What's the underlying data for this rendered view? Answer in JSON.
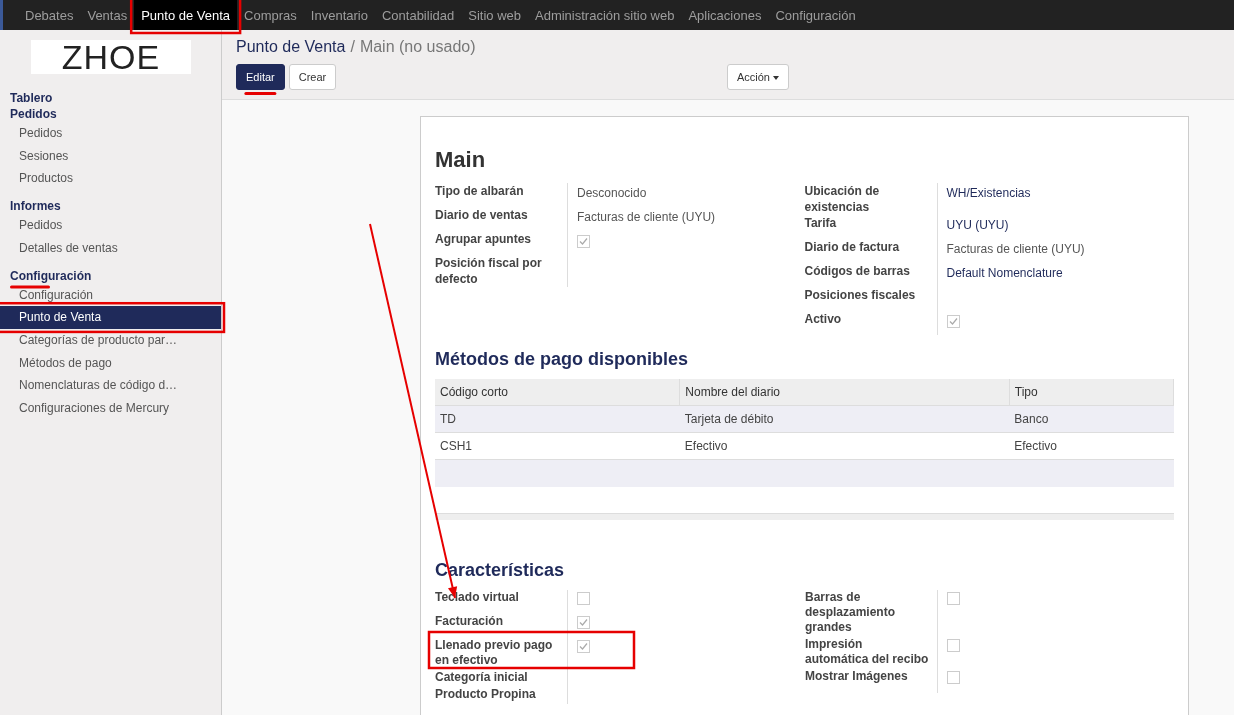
{
  "top_menu": [
    {
      "label": "Debates",
      "selected": false,
      "boxed": false
    },
    {
      "label": "Ventas",
      "selected": false,
      "boxed": false
    },
    {
      "label": "Punto de Venta",
      "selected": true,
      "boxed": true
    },
    {
      "label": "Compras",
      "selected": false,
      "boxed": false
    },
    {
      "label": "Inventario",
      "selected": false,
      "boxed": false
    },
    {
      "label": "Contabilidad",
      "selected": false,
      "boxed": false
    },
    {
      "label": "Sitio web",
      "selected": false,
      "boxed": false
    },
    {
      "label": "Administración sitio web",
      "selected": false,
      "boxed": false
    },
    {
      "label": "Aplicaciones",
      "selected": false,
      "boxed": false
    },
    {
      "label": "Configuración",
      "selected": false,
      "boxed": false
    }
  ],
  "logo": {
    "text": "ZHOE"
  },
  "sidebar": {
    "sections": [
      {
        "title": "Tablero",
        "underlined": false
      },
      {
        "title": "Pedidos",
        "underlined": false,
        "items": [
          {
            "label": "Pedidos",
            "selected": false,
            "boxed": false
          },
          {
            "label": "Sesiones",
            "selected": false,
            "boxed": false
          },
          {
            "label": "Productos",
            "selected": false,
            "boxed": false
          }
        ]
      },
      {
        "title": "Informes",
        "underlined": false,
        "items": [
          {
            "label": "Pedidos",
            "selected": false,
            "boxed": false
          },
          {
            "label": "Detalles de ventas",
            "selected": false,
            "boxed": false
          }
        ]
      },
      {
        "title": "Configuración",
        "underlined": true,
        "items": [
          {
            "label": "Configuración",
            "selected": false,
            "boxed": false
          },
          {
            "label": "Punto de Venta",
            "selected": true,
            "boxed": true
          },
          {
            "label": "Categorías de producto par…",
            "selected": false,
            "boxed": false
          },
          {
            "label": "Métodos de pago",
            "selected": false,
            "boxed": false
          },
          {
            "label": "Nomenclaturas de código d…",
            "selected": false,
            "boxed": false
          },
          {
            "label": "Configuraciones de Mercury",
            "selected": false,
            "boxed": false
          }
        ]
      }
    ]
  },
  "breadcrumb": {
    "parent": "Punto de Venta",
    "separator": "/",
    "current": "Main (no usado)"
  },
  "buttons": [
    {
      "label": "Editar",
      "kind": "primary",
      "underlined": true
    },
    {
      "label": "Crear",
      "kind": "secondary",
      "underlined": false
    }
  ],
  "action_menu": {
    "label": "Acción"
  },
  "form": {
    "title": "Main",
    "groups": [
      [
        {
          "label": "Tipo de albarán",
          "kind": "text",
          "value": "Desconocido"
        },
        {
          "label": "Diario de ventas",
          "kind": "text",
          "value": "Facturas de cliente (UYU)"
        },
        {
          "label": "Agrupar apuntes",
          "kind": "checkbox",
          "checked": true
        },
        {
          "label": "Posición fiscal por defecto",
          "kind": "empty"
        }
      ],
      [
        {
          "label": "Ubicación de existencias",
          "kind": "link",
          "value": "WH/Existencias"
        },
        {
          "label": "Tarifa",
          "kind": "link",
          "value": "UYU (UYU)"
        },
        {
          "label": "Diario de factura",
          "kind": "text",
          "value": "Facturas de cliente (UYU)"
        },
        {
          "label": "Códigos de barras",
          "kind": "link",
          "value": "Default Nomenclature"
        },
        {
          "label": "Posiciones fiscales",
          "kind": "empty"
        },
        {
          "label": "Activo",
          "kind": "checkbox",
          "checked": true
        }
      ]
    ],
    "payment_title": "Métodos de pago disponibles",
    "payment_table": {
      "columns": [
        "Código corto",
        "Nombre del diario",
        "Tipo"
      ],
      "rows": [
        [
          "TD",
          "Tarjeta de débito",
          "Banco"
        ],
        [
          "CSH1",
          "Efectivo",
          "Efectivo"
        ]
      ]
    },
    "features_title": "Características",
    "features": [
      [
        {
          "label": "Teclado virtual",
          "kind": "checkbox",
          "checked": false,
          "boxed": false
        },
        {
          "label": "Facturación",
          "kind": "checkbox",
          "checked": true,
          "boxed": false
        },
        {
          "label": "Llenado previo pago en efectivo",
          "kind": "checkbox",
          "checked": true,
          "boxed": true
        },
        {
          "label": "Categoría inicial",
          "kind": "empty",
          "boxed": false
        },
        {
          "label": "Producto Propina",
          "kind": "empty",
          "boxed": false
        }
      ],
      [
        {
          "label": "Barras de desplazamiento grandes",
          "kind": "checkbox",
          "checked": false,
          "boxed": false
        },
        {
          "label": "Impresión automática del recibo",
          "kind": "checkbox",
          "checked": false,
          "boxed": false
        },
        {
          "label": "Mostrar Imágenes",
          "kind": "checkbox",
          "checked": false,
          "boxed": false
        }
      ]
    ]
  }
}
